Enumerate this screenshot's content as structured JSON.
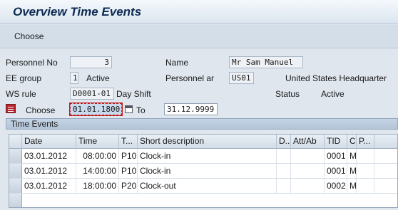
{
  "window": {
    "title": "Overview Time Events"
  },
  "toolbar": {
    "choose_label": "Choose"
  },
  "header": {
    "personnel_no_label": "Personnel No",
    "personnel_no_value": "3",
    "name_label": "Name",
    "name_value": "Mr Sam Manuel",
    "ee_group_label": "EE group",
    "ee_group_value": "1",
    "ee_group_text": "Active",
    "personnel_area_label": "Personnel ar",
    "personnel_area_value": "US01",
    "personnel_area_text": "United States Headquarter",
    "ws_rule_label": "WS rule",
    "ws_rule_value": "D0001-01",
    "ws_rule_text": "Day Shift",
    "status_label": "Status",
    "status_text": "Active"
  },
  "selection": {
    "choose_label": "Choose",
    "from_value": "01.01.1800",
    "to_label": "To",
    "to_value": "31.12.9999"
  },
  "panel": {
    "title": "Time Events"
  },
  "table": {
    "columns": [
      "Date",
      "Time",
      "T...",
      "Short description",
      "D..",
      "Att/Ab",
      "TID",
      "C",
      "P..."
    ],
    "rows": [
      [
        "03.01.2012",
        "08:00:00",
        "P10",
        "Clock-in",
        "",
        "",
        "0001",
        "M",
        ""
      ],
      [
        "03.01.2012",
        "14:00:00",
        "P10",
        "Clock-in",
        "",
        "",
        "0001",
        "M",
        ""
      ],
      [
        "03.01.2012",
        "18:00:00",
        "P20",
        "Clock-out",
        "",
        "",
        "0002",
        "M",
        ""
      ]
    ]
  },
  "icons": {
    "selection": "list-selection-icon",
    "calendar": "calendar-icon"
  },
  "colors": {
    "title": "#0c2a52",
    "focus_border": "#c21a1a",
    "background": "#dfe6ee"
  }
}
